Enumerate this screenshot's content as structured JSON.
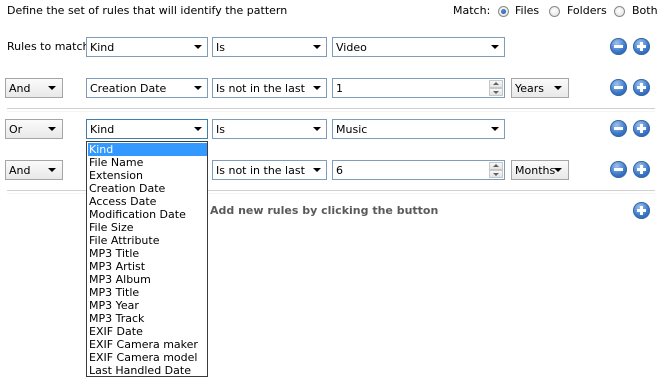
{
  "header": {
    "instruction": "Define the set of rules that will identify the pattern",
    "match_label": "Match:",
    "options": [
      {
        "label": "Files",
        "selected": true
      },
      {
        "label": "Folders",
        "selected": false
      },
      {
        "label": "Both",
        "selected": false
      }
    ]
  },
  "rules_to_match_label": "Rules to match:",
  "group1": {
    "rule1": {
      "field": "Kind",
      "operator": "Is",
      "value": "Video"
    },
    "rule2": {
      "connector": "And",
      "field": "Creation Date",
      "operator": "Is not in the last",
      "amount": "1",
      "unit": "Years"
    }
  },
  "group2": {
    "rule1": {
      "connector": "Or",
      "field": "Kind",
      "operator": "Is",
      "value": "Music"
    },
    "rule2": {
      "connector": "And",
      "operator": "Is not in the last",
      "amount": "6",
      "unit": "Months"
    }
  },
  "add_hint": "Add new rules by clicking the button",
  "dropdown": {
    "selected": "Kind",
    "options": [
      "Kind",
      "File Name",
      "Extension",
      "Creation Date",
      "Access Date",
      "Modification Date",
      "File Size",
      "File Attribute",
      "MP3 Title",
      "MP3 Artist",
      "MP3 Album",
      "MP3 Title",
      "MP3 Year",
      "MP3 Track",
      "EXIF Date",
      "EXIF Camera maker",
      "EXIF Camera model",
      "Last Handled Date"
    ]
  },
  "colors": {
    "accent": "#3399ff",
    "button_blue": "#3b78c9",
    "border": "#7f9db9"
  }
}
